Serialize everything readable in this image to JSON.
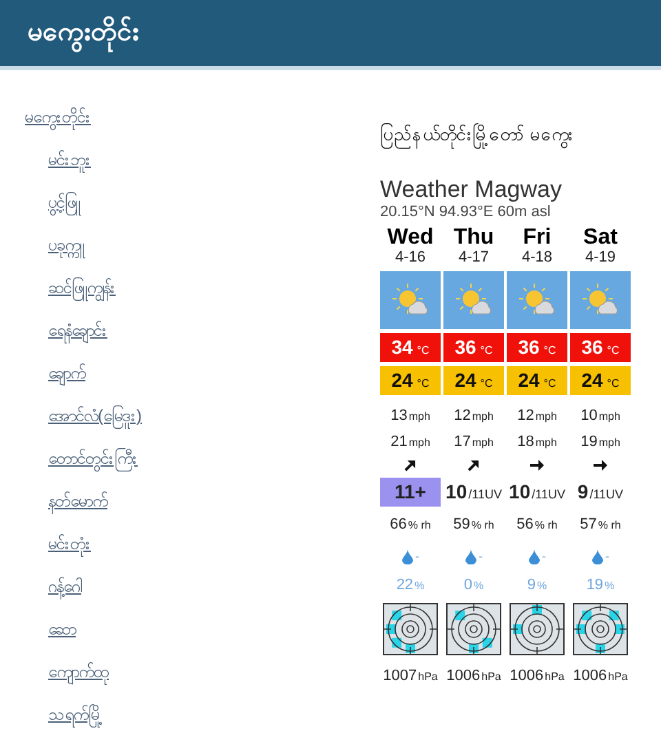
{
  "header": {
    "title": "မကွေးတိုင်း"
  },
  "nav": {
    "label": "မကွေးတိုင်း",
    "children": [
      {
        "label": "မင်းဘူး"
      },
      {
        "label": "ပွင့်ဖြူ"
      },
      {
        "label": "ပခုက္ကူ"
      },
      {
        "label": "ဆင်ဖြူကျွန်း"
      },
      {
        "label": "ရေနံချောင်း"
      },
      {
        "label": "ချောက်"
      },
      {
        "label": "အောင်လံ(မြေဒူး)"
      },
      {
        "label": "တောင်တွင်းကြီး"
      },
      {
        "label": "နတ်မောက်"
      },
      {
        "label": "မင်းတုံး"
      },
      {
        "label": "ဂန့်ဂေါ"
      },
      {
        "label": "ဆော"
      },
      {
        "label": "ကျောက်ထု"
      },
      {
        "label": "သရက်မြို့"
      }
    ]
  },
  "widget": {
    "heading": "ပြည်နယ်တိုင်းမြို့တော် မကွေး",
    "title": "Weather Magway",
    "coords": "20.15°N 94.93°E 60m asl",
    "days": [
      {
        "day": "Wed",
        "date": "4-16",
        "max": "34",
        "max_unit": "°C",
        "min": "24",
        "min_unit": "°C",
        "wind": "13",
        "wind_unit": "mph",
        "gust": "21",
        "gust_unit": "mph",
        "wind_arrow": {
          "kind": "northeast"
        },
        "uv": "11+",
        "uv_extreme": true,
        "rh": "66",
        "rh_unit": "% rh",
        "precip": "-",
        "prob": "22",
        "prob_unit": "%",
        "pressure": "1007",
        "pressure_unit": "hPa"
      },
      {
        "day": "Thu",
        "date": "4-17",
        "max": "36",
        "max_unit": "°C",
        "min": "24",
        "min_unit": "°C",
        "wind": "12",
        "wind_unit": "mph",
        "gust": "17",
        "gust_unit": "mph",
        "wind_arrow": {
          "kind": "northeast"
        },
        "uv": "10",
        "uv_unit": "/11UV",
        "uv_extreme": false,
        "rh": "59",
        "rh_unit": "% rh",
        "precip": "-",
        "prob": "0",
        "prob_unit": "%",
        "pressure": "1006",
        "pressure_unit": "hPa"
      },
      {
        "day": "Fri",
        "date": "4-18",
        "max": "36",
        "max_unit": "°C",
        "min": "24",
        "min_unit": "°C",
        "wind": "12",
        "wind_unit": "mph",
        "gust": "18",
        "gust_unit": "mph",
        "wind_arrow": {
          "kind": "east"
        },
        "uv": "10",
        "uv_unit": "/11UV",
        "uv_extreme": false,
        "rh": "56",
        "rh_unit": "% rh",
        "precip": "-",
        "prob": "9",
        "prob_unit": "%",
        "pressure": "1006",
        "pressure_unit": "hPa"
      },
      {
        "day": "Sat",
        "date": "4-19",
        "max": "36",
        "max_unit": "°C",
        "min": "24",
        "min_unit": "°C",
        "wind": "10",
        "wind_unit": "mph",
        "gust": "19",
        "gust_unit": "mph",
        "wind_arrow": {
          "kind": "east"
        },
        "uv": "9",
        "uv_unit": "/11UV",
        "uv_extreme": false,
        "rh": "57",
        "rh_unit": "% rh",
        "precip": "-",
        "prob": "19",
        "prob_unit": "%",
        "pressure": "1006",
        "pressure_unit": "hPa"
      }
    ]
  }
}
